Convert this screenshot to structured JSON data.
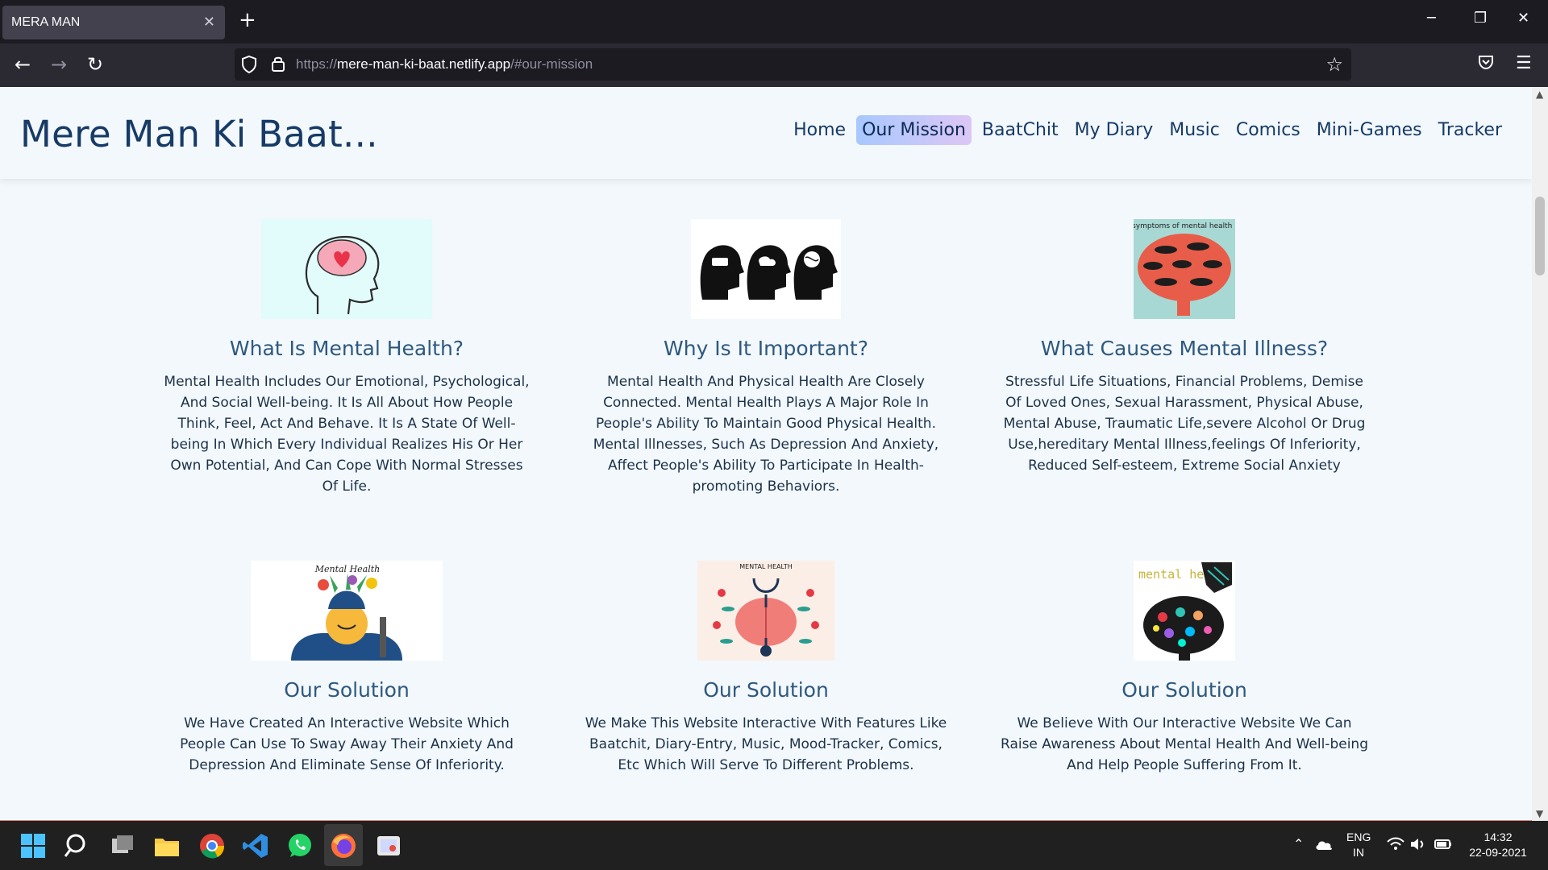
{
  "browser": {
    "tab_title": "MERA MAN",
    "url_scheme": "https://",
    "url_host": "mere-man-ki-baat.netlify.app",
    "url_path": "/#our-mission"
  },
  "site": {
    "brand": "Mere Man Ki Baat...",
    "nav": [
      {
        "label": "Home",
        "active": false
      },
      {
        "label": "Our Mission",
        "active": true
      },
      {
        "label": "BaatChit",
        "active": false
      },
      {
        "label": "My Diary",
        "active": false
      },
      {
        "label": "Music",
        "active": false
      },
      {
        "label": "Comics",
        "active": false
      },
      {
        "label": "Mini-Games",
        "active": false
      },
      {
        "label": "Tracker",
        "active": false
      }
    ]
  },
  "cards": [
    {
      "title": "What Is Mental Health?",
      "text": "Mental Health Includes Our Emotional, Psychological, And Social Well-being. It Is All About How People Think, Feel, Act And Behave. It Is A State Of Well-being In Which Every Individual Realizes His Or Her Own Potential, And Can Cope With Normal Stresses Of Life.",
      "image": "brain-heart-illustration"
    },
    {
      "title": "Why Is It Important?",
      "text": "Mental Health And Physical Health Are Closely Connected. Mental Health Plays A Major Role In People's Ability To Maintain Good Physical Health. Mental Illnesses, Such As Depression And Anxiety, Affect People's Ability To Participate In Health-promoting Behaviors.",
      "image": "three-heads-illustration"
    },
    {
      "title": "What Causes Mental Illness?",
      "text": "Stressful Life Situations, Financial Problems, Demise Of Loved Ones, Sexual Harassment, Physical Abuse, Mental Abuse, Traumatic Life,severe Alcohol Or Drug Use,hereditary Mental Illness,feelings Of Inferiority, Reduced Self-esteem, Extreme Social Anxiety",
      "image": "symptoms-brain-poster",
      "image_text": "early symptoms of mental health illness"
    },
    {
      "title": "Our Solution",
      "text": "We Have Created An Interactive Website Which People Can Use To Sway Away Their Anxiety And Depression And Eliminate Sense Of Inferiority.",
      "image": "mental-health-flowers-illustration",
      "image_text": "Mental Health"
    },
    {
      "title": "Our Solution",
      "text": "We Make This Website Interactive With Features Like Baatchit, Diary-Entry, Music, Mood-Tracker, Comics, Etc Which Will Serve To Different Problems.",
      "image": "stethoscope-brain-illustration",
      "image_text": "MENTAL HEALTH"
    },
    {
      "title": "Our Solution",
      "text": "We Believe With Our Interactive Website We Can Raise Awareness About Mental Health And Well-being And Help People Suffering From It.",
      "image": "colorful-brain-illustration",
      "image_text": "mental health"
    }
  ],
  "taskbar": {
    "language": "ENG",
    "region": "IN",
    "time": "14:32",
    "date": "22-09-2021"
  },
  "colors": {
    "accent": "#173a66",
    "active_nav_gradient": [
      "#a8c8ff",
      "#dcc7f5"
    ],
    "page_bg": "#f2f8fc"
  }
}
